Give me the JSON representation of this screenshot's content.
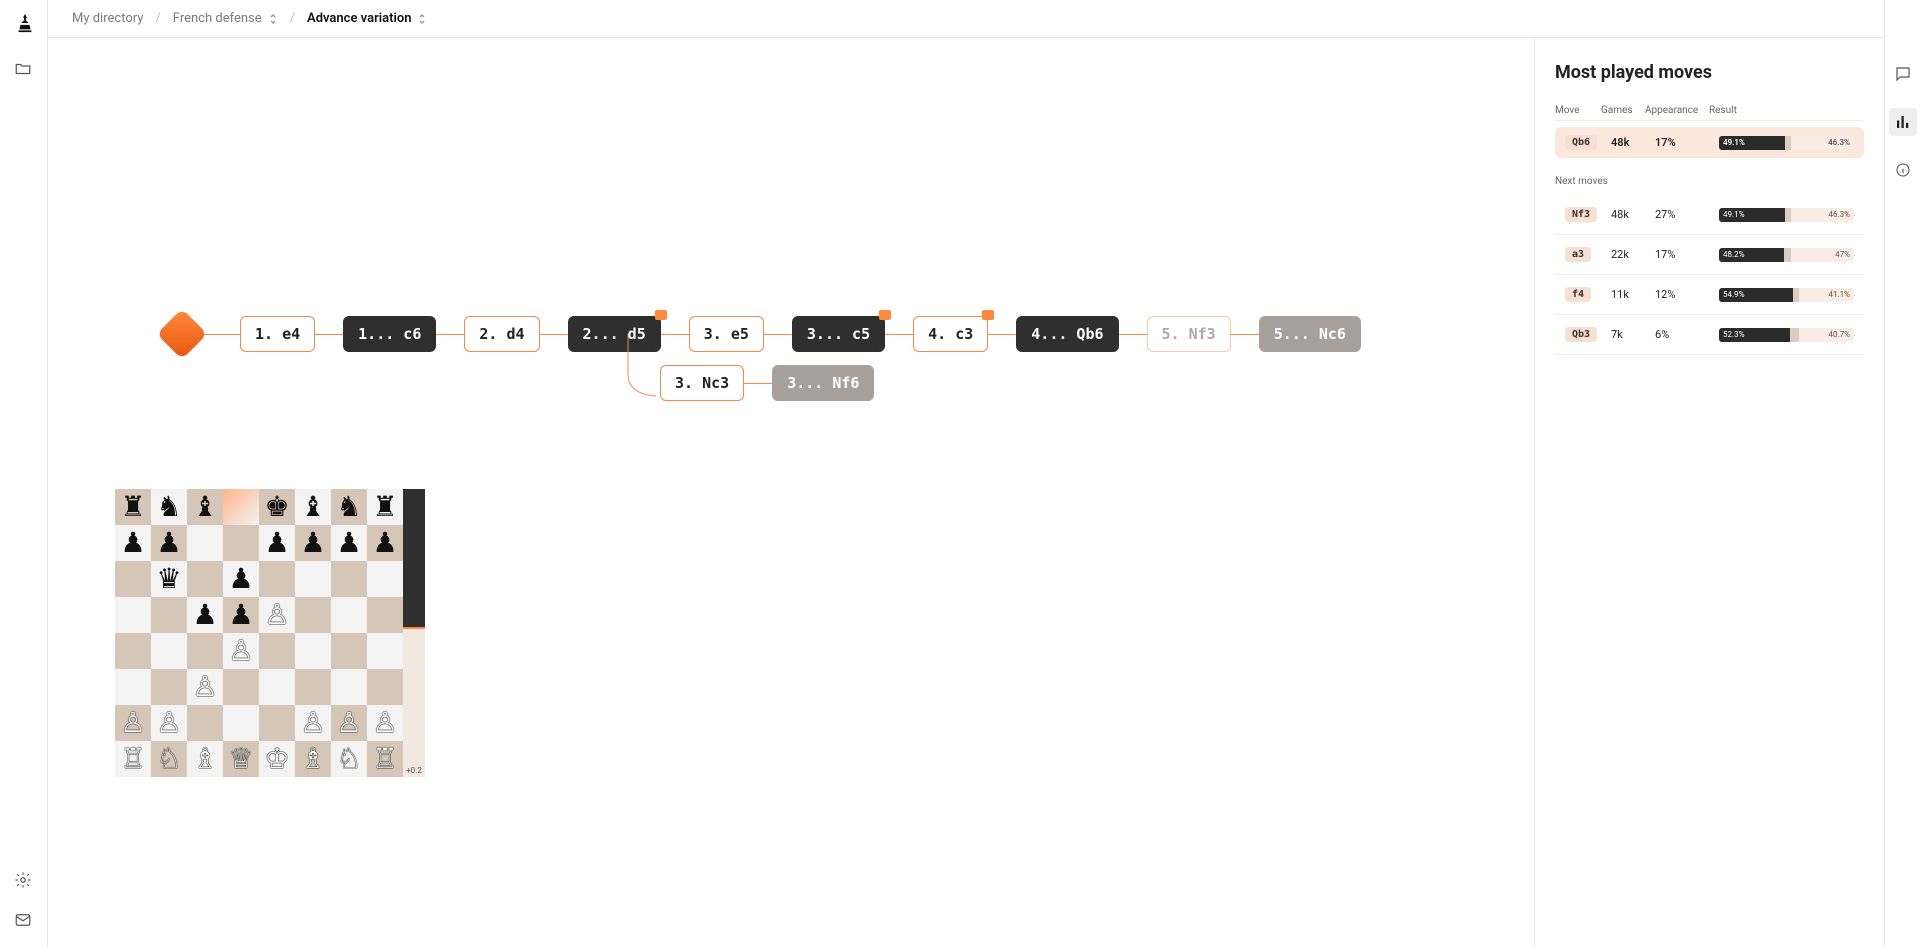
{
  "breadcrumb": {
    "root": "My directory",
    "parent": "French defense",
    "current": "Advance variation"
  },
  "tree": {
    "main": [
      {
        "label": "1. e4",
        "side": "white",
        "note": false
      },
      {
        "label": "1... c6",
        "side": "black",
        "note": false
      },
      {
        "label": "2. d4",
        "side": "white",
        "note": false
      },
      {
        "label": "2... d5",
        "side": "black",
        "note": true
      },
      {
        "label": "3. e5",
        "side": "white",
        "note": false
      },
      {
        "label": "3... c5",
        "side": "black",
        "note": true
      },
      {
        "label": "4. c3",
        "side": "white",
        "note": true
      },
      {
        "label": "4... Qb6",
        "side": "black",
        "note": false
      },
      {
        "label": "5. Nf3",
        "side": "ghost",
        "note": false
      },
      {
        "label": "5... Nc6",
        "side": "gray",
        "note": false
      }
    ],
    "branch": [
      {
        "label": "3. Nc3",
        "side": "white",
        "note": false
      },
      {
        "label": "3... Nf6",
        "side": "gray",
        "note": false
      }
    ]
  },
  "board": {
    "highlight": "d8",
    "pieces": {
      "a8": "br",
      "b8": "bn",
      "c8": "bb",
      "e8": "bk",
      "f8": "bb",
      "g8": "bn",
      "h8": "br",
      "a7": "bp",
      "b7": "bp",
      "e7": "bp",
      "f7": "bp",
      "g7": "bp",
      "h7": "bp",
      "b6": "bq",
      "d6": "bp",
      "c5": "bp",
      "d5": "bp",
      "e5": "wp",
      "d4": "wp",
      "c3": "wp",
      "a2": "wp",
      "b2": "wp",
      "f2": "wp",
      "g2": "wp",
      "h2": "wp",
      "a1": "wr",
      "b1": "wn",
      "c1": "wb",
      "d1": "wq",
      "e1": "wk",
      "f1": "wb",
      "g1": "wn",
      "h1": "wr"
    },
    "eval": "+0.2"
  },
  "side_panel": {
    "title": "Most played moves",
    "headers": {
      "move": "Move",
      "games": "Games",
      "appearance": "Appearance",
      "result": "Result"
    },
    "featured": {
      "move": "Qb6",
      "games": "48k",
      "appearance": "17%",
      "win": 49.1,
      "draw": 4.6,
      "loss": 46.3,
      "win_s": "49.1%",
      "loss_s": "46.3%"
    },
    "next_label": "Next moves",
    "rows": [
      {
        "move": "Nf3",
        "games": "48k",
        "appearance": "27%",
        "win": 49.1,
        "draw": 4.6,
        "loss": 46.3,
        "win_s": "49.1%",
        "loss_s": "46.3%"
      },
      {
        "move": "a3",
        "games": "22k",
        "appearance": "17%",
        "win": 48.2,
        "draw": 4.8,
        "loss": 47.0,
        "win_s": "48.2%",
        "loss_s": "47%"
      },
      {
        "move": "f4",
        "games": "11k",
        "appearance": "12%",
        "win": 54.9,
        "draw": 4.0,
        "loss": 41.1,
        "win_s": "54.9%",
        "loss_s": "41.1%"
      },
      {
        "move": "Qb3",
        "games": "7k",
        "appearance": "6%",
        "win": 52.3,
        "draw": 7.0,
        "loss": 40.7,
        "win_s": "52.3%",
        "loss_s": "40.7%"
      }
    ]
  }
}
